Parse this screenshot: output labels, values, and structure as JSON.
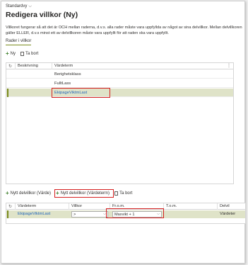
{
  "view_label": "Standardvy",
  "page_title": "Redigera villkor (Ny)",
  "description": "Villkoret fungerar så att det är OCH mellan raderna, d.v.s. alla rader måste vara uppfyllda av något av sina delvillkor. Mellan delvillkoren gäller ELLER, d.v.s minst ett av delvillkoren måste vara uppfyllt för att raden ska vara uppfyllt.",
  "tab_label": "Rader i villkor",
  "toolbar1": {
    "new_label": "Ny",
    "delete_label": "Ta bort"
  },
  "grid1": {
    "headers": [
      "Beskrivning",
      "Värdeterm"
    ],
    "rows": [
      {
        "beskrivning": "",
        "vardeterm": "Berighetsklass"
      },
      {
        "beskrivning": "",
        "vardeterm": "FulltLass"
      },
      {
        "beskrivning": "",
        "vardeterm": "EkipageViktmLast"
      }
    ]
  },
  "toolbar2": {
    "new_sub_value_label": "Nytt delvillkor (Värde)",
    "new_sub_term_label": "Nytt delvillkor (Värdeterm)",
    "delete_label": "Ta bort"
  },
  "grid2": {
    "headers": [
      "Värdeterm",
      "Villkor",
      "Fr.o.m.",
      "T.o.m.",
      "Delvil"
    ],
    "row": {
      "vardeterm": "EkipageViktmLast",
      "villkor": ">",
      "from": "Maxvikt + 1",
      "tom": "",
      "delvil": "Värdeter"
    }
  },
  "colors": {
    "accent": "#7a8b1c",
    "selected_row": "#dfe3c8",
    "highlight": "#d62020",
    "link": "#2266bb"
  }
}
